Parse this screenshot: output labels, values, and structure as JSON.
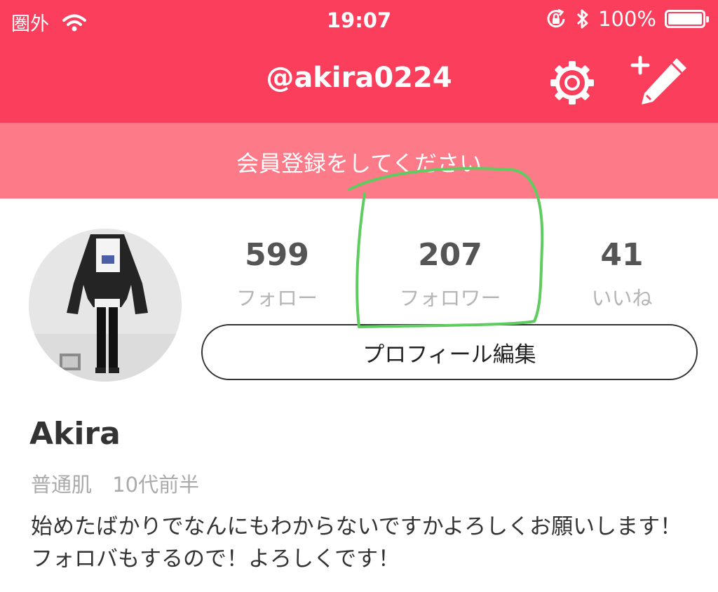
{
  "status_bar": {
    "carrier": "圏外",
    "time": "19:07",
    "battery_text": "100%",
    "battery_level": 1.0
  },
  "header": {
    "title": "@akira0224",
    "settings_icon": "gear-icon",
    "compose_icon": "compose-pencil-icon"
  },
  "banner": {
    "text": "会員登録をしてください"
  },
  "profile": {
    "stats": [
      {
        "value": "599",
        "label": "フォロー"
      },
      {
        "value": "207",
        "label": "フォロワー"
      },
      {
        "value": "41",
        "label": "いいね"
      }
    ],
    "edit_button": "プロフィール編集",
    "name": "Akira",
    "skin_type": "普通肌",
    "age": "10代前半",
    "bio": "始めたばかりでなんにもわからないですかよろしくお願いします！フォロバもするので！よろしくです！"
  },
  "colors": {
    "header": "#fb3e5b",
    "banner": "#fd7a89",
    "annotation": "#5fcc5f"
  }
}
